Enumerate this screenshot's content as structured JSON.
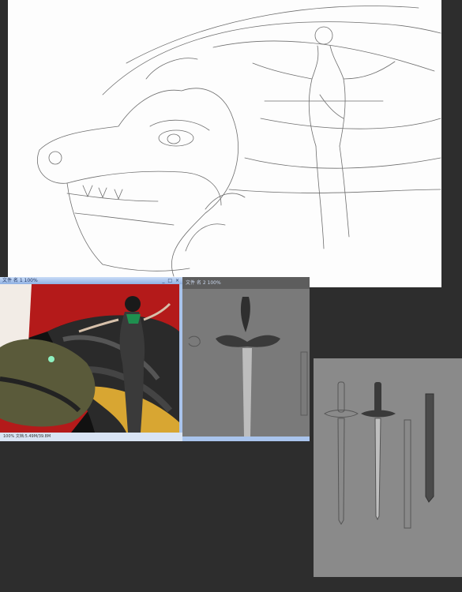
{
  "sketch_panel": {
    "description_icon": "dragon-and-elf-sketch"
  },
  "color_window": {
    "title": "文件 名 1 100%",
    "buttons": "_ □ ×",
    "zoom": "100% 文档:5.49M/39.8M"
  },
  "gray_window": {
    "title": "文件 名 2 100%"
  },
  "sword_panel": {
    "description_icon": "sword-designs"
  },
  "colors": {
    "background": "#2d2d2d",
    "window_chrome": "#a9c4ec",
    "dragon_red": "#b41a1a",
    "gold": "#d8a632"
  }
}
